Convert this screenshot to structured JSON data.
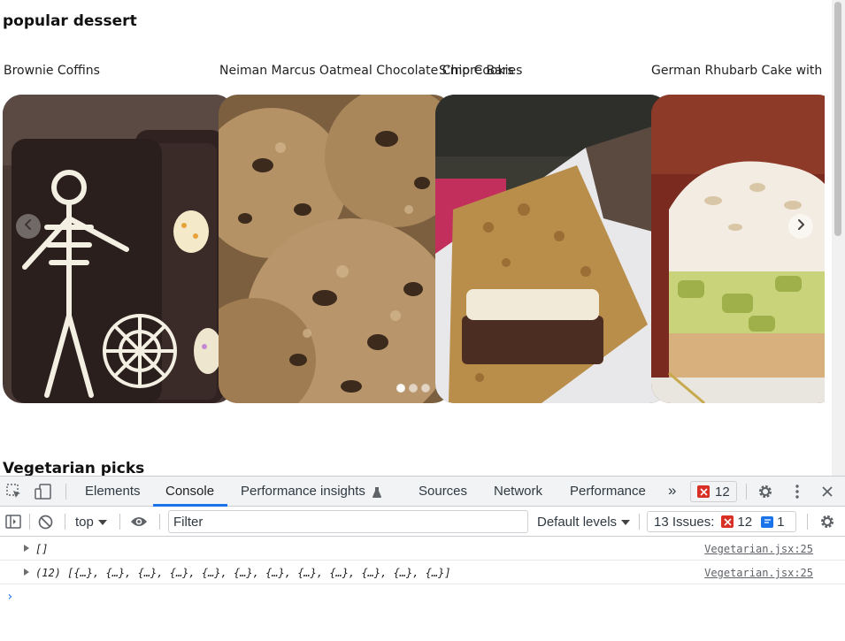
{
  "page": {
    "sections": [
      {
        "title": "popular dessert"
      },
      {
        "title": "Vegetarian picks"
      }
    ],
    "carousel": {
      "cards": [
        {
          "label": "Brownie Coffins",
          "image": "brownie-coffins-photo"
        },
        {
          "label": "Neiman Marcus Oatmeal Chocolate Chip Cookies",
          "image": "oatmeal-cookies-photo"
        },
        {
          "label": "S'more Bars",
          "image": "smore-bars-photo"
        },
        {
          "label": "German Rhubarb Cake with Meringue",
          "image": "rhubarb-cake-photo"
        }
      ],
      "prev_icon": "chevron-left-icon",
      "next_icon": "chevron-right-icon",
      "pagination_dots": 3,
      "active_dot": 1
    }
  },
  "devtools": {
    "tabs": [
      "Elements",
      "Console",
      "Performance insights",
      "Sources",
      "Network",
      "Performance"
    ],
    "active_tab": "Console",
    "more_tabs": "»",
    "error_count": "12",
    "toolbar": {
      "context": "top",
      "filter_placeholder": "Filter",
      "levels": "Default levels",
      "issues_label": "13 Issues:",
      "issues_errors": "12",
      "issues_messages": "1"
    },
    "logs": [
      {
        "text": "[]",
        "source": "Vegetarian.jsx:25"
      },
      {
        "text": "(12) [{…}, {…}, {…}, {…}, {…}, {…}, {…}, {…}, {…}, {…}, {…}, {…}]",
        "source": "Vegetarian.jsx:25"
      }
    ],
    "prompt": "›"
  },
  "colors": {
    "accent": "#1a73e8",
    "error": "#d93025"
  }
}
